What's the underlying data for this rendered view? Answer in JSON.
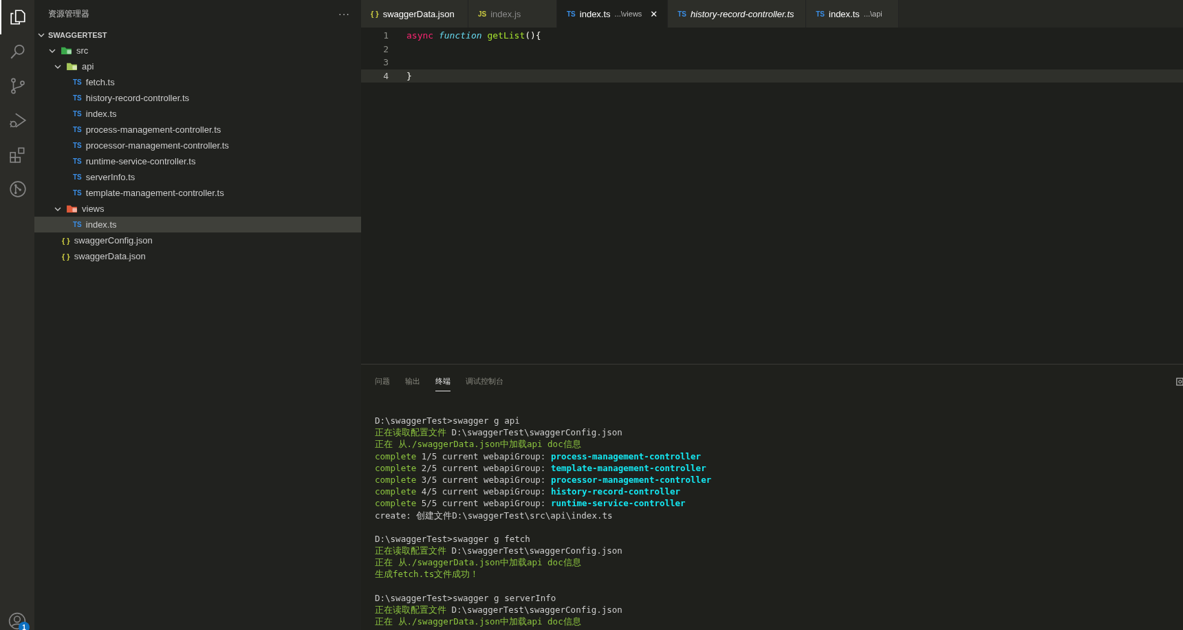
{
  "activity_bar": {
    "items": [
      {
        "kind": "explorer",
        "selected": true
      },
      {
        "kind": "search",
        "selected": false
      },
      {
        "kind": "source-control",
        "selected": false
      },
      {
        "kind": "run",
        "selected": false
      },
      {
        "kind": "extensions",
        "selected": false
      },
      {
        "kind": "graph",
        "selected": false
      }
    ],
    "account": {
      "badge": "1"
    }
  },
  "sidebar": {
    "title": "资源管理器",
    "more": "···",
    "section": {
      "title": "SWAGGERTEST",
      "expanded": true
    },
    "tree": [
      {
        "label": "src",
        "kind": "folder-src",
        "expanded": true,
        "selected": false,
        "children": [
          {
            "label": "api",
            "kind": "folder-api",
            "expanded": true,
            "selected": false,
            "children": [
              {
                "icon": "TS",
                "label": "fetch.ts",
                "kind": "ts",
                "selected": false
              },
              {
                "icon": "TS",
                "label": "history-record-controller.ts",
                "kind": "ts",
                "selected": false
              },
              {
                "icon": "TS",
                "label": "index.ts",
                "kind": "ts",
                "selected": false
              },
              {
                "icon": "TS",
                "label": "process-management-controller.ts",
                "kind": "ts",
                "selected": false
              },
              {
                "icon": "TS",
                "label": "processor-management-controller.ts",
                "kind": "ts",
                "selected": false
              },
              {
                "icon": "TS",
                "label": "runtime-service-controller.ts",
                "kind": "ts",
                "selected": false
              },
              {
                "icon": "TS",
                "label": "serverInfo.ts",
                "kind": "ts",
                "selected": false
              },
              {
                "icon": "TS",
                "label": "template-management-controller.ts",
                "kind": "ts",
                "selected": false
              }
            ]
          },
          {
            "label": "views",
            "kind": "folder-views",
            "expanded": true,
            "selected": false,
            "children": [
              {
                "icon": "TS",
                "label": "index.ts",
                "kind": "ts",
                "selected": true
              }
            ]
          }
        ]
      },
      {
        "icon": "{ }",
        "label": "swaggerConfig.json",
        "kind": "json",
        "selected": false
      },
      {
        "icon": "{ }",
        "label": "swaggerData.json",
        "kind": "json",
        "selected": false
      }
    ]
  },
  "tabs": [
    {
      "icon": "{ }",
      "kind": "json",
      "label": "swaggerData.json",
      "selected": false,
      "italic": false,
      "dimmed": false
    },
    {
      "icon": "JS",
      "kind": "js",
      "label": "index.js",
      "selected": false,
      "italic": false,
      "dimmed": true
    },
    {
      "icon": "TS",
      "kind": "ts",
      "label": "index.ts",
      "description": "...\\views",
      "selected": true,
      "italic": false,
      "dimmed": false,
      "close": "✕"
    },
    {
      "icon": "TS",
      "kind": "ts",
      "label": "history-record-controller.ts",
      "selected": false,
      "italic": true,
      "dimmed": false
    },
    {
      "icon": "TS",
      "kind": "ts",
      "label": "index.ts",
      "description": "...\\api",
      "selected": false,
      "italic": false,
      "dimmed": false
    }
  ],
  "editor": {
    "lines": [
      {
        "number": "1",
        "current": false,
        "tokens": [
          {
            "kind": "keyword",
            "text": "async"
          },
          {
            "kind": "storage",
            "text": "function"
          },
          {
            "kind": "func",
            "text": "getList"
          },
          {
            "kind": "bracket",
            "text": "(){"
          }
        ]
      },
      {
        "number": "2",
        "current": false
      },
      {
        "number": "3",
        "current": false
      },
      {
        "number": "4",
        "current": true,
        "tokens": [
          {
            "kind": "bracket",
            "text": "}"
          }
        ]
      }
    ]
  },
  "panel": {
    "tabs": [
      {
        "label": "问题",
        "selected": false
      },
      {
        "label": "输出",
        "selected": false
      },
      {
        "label": "终端",
        "selected": true
      },
      {
        "label": "调试控制台",
        "selected": false
      }
    ],
    "terminal": {
      "blocks": [
        {
          "lines": [
            {
              "parts": [
                {
                  "kind": "plain",
                  "text": "D:\\swaggerTest>swagger g api"
                }
              ]
            },
            {
              "parts": [
                {
                  "kind": "info",
                  "text": "正在读取配置文件"
                },
                {
                  "kind": "plain",
                  "text": " D:\\swaggerTest\\swaggerConfig.json"
                }
              ]
            },
            {
              "parts": [
                {
                  "kind": "info",
                  "text": "正在 从./swaggerData.json中加载api doc信息"
                }
              ]
            },
            {
              "parts": [
                {
                  "kind": "info",
                  "text": "complete"
                },
                {
                  "kind": "plain",
                  "text": " 1/5 current webapiGroup: "
                },
                {
                  "kind": "highlight",
                  "text": "process-management-controller"
                }
              ]
            },
            {
              "parts": [
                {
                  "kind": "info",
                  "text": "complete"
                },
                {
                  "kind": "plain",
                  "text": " 2/5 current webapiGroup: "
                },
                {
                  "kind": "highlight",
                  "text": "template-management-controller"
                }
              ]
            },
            {
              "parts": [
                {
                  "kind": "info",
                  "text": "complete"
                },
                {
                  "kind": "plain",
                  "text": " 3/5 current webapiGroup: "
                },
                {
                  "kind": "highlight",
                  "text": "processor-management-controller"
                }
              ]
            },
            {
              "parts": [
                {
                  "kind": "info",
                  "text": "complete"
                },
                {
                  "kind": "plain",
                  "text": " 4/5 current webapiGroup: "
                },
                {
                  "kind": "highlight",
                  "text": "history-record-controller"
                }
              ]
            },
            {
              "parts": [
                {
                  "kind": "info",
                  "text": "complete"
                },
                {
                  "kind": "plain",
                  "text": " 5/5 current webapiGroup: "
                },
                {
                  "kind": "highlight",
                  "text": "runtime-service-controller"
                }
              ]
            },
            {
              "parts": [
                {
                  "kind": "plain",
                  "text": "create: 创建文件D:\\swaggerTest\\src\\api\\index.ts"
                }
              ]
            }
          ]
        },
        {
          "lines": [
            {
              "parts": [
                {
                  "kind": "plain",
                  "text": "D:\\swaggerTest>swagger g fetch"
                }
              ]
            },
            {
              "parts": [
                {
                  "kind": "info",
                  "text": "正在读取配置文件"
                },
                {
                  "kind": "plain",
                  "text": " D:\\swaggerTest\\swaggerConfig.json"
                }
              ]
            },
            {
              "parts": [
                {
                  "kind": "info",
                  "text": "正在 从./swaggerData.json中加载api doc信息"
                }
              ]
            },
            {
              "parts": [
                {
                  "kind": "info",
                  "text": "生成fetch.ts文件成功！"
                }
              ]
            }
          ]
        },
        {
          "lines": [
            {
              "parts": [
                {
                  "kind": "plain",
                  "text": "D:\\swaggerTest>swagger g serverInfo"
                }
              ]
            },
            {
              "parts": [
                {
                  "kind": "info",
                  "text": "正在读取配置文件"
                },
                {
                  "kind": "plain",
                  "text": " D:\\swaggerTest\\swaggerConfig.json"
                }
              ]
            },
            {
              "parts": [
                {
                  "kind": "info",
                  "text": "正在 从./swaggerData.json中加载api doc信息"
                }
              ]
            }
          ]
        }
      ]
    }
  }
}
